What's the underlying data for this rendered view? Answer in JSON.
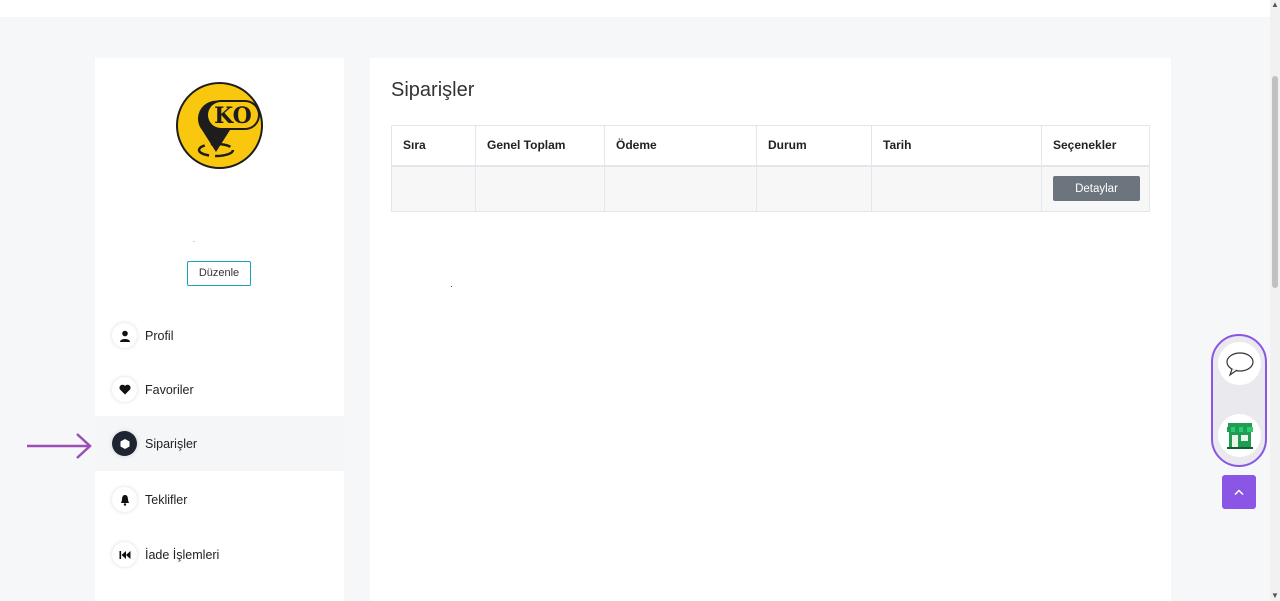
{
  "sidebar": {
    "edit_button": "Düzenle",
    "items": [
      {
        "label": "Profil",
        "icon": "user-icon"
      },
      {
        "label": "Favoriler",
        "icon": "heart-icon"
      },
      {
        "label": "Siparişler",
        "icon": "hexagon-icon",
        "active": true
      },
      {
        "label": "Teklifler",
        "icon": "bell-icon"
      },
      {
        "label": "İade İşlemleri",
        "icon": "rewind-icon"
      }
    ]
  },
  "logo": {
    "text": "KO"
  },
  "main": {
    "title": "Siparişler",
    "table": {
      "headers": [
        "Sıra",
        "Genel Toplam",
        "Ödeme",
        "Durum",
        "Tarih",
        "Seçenekler"
      ],
      "rows": [
        {
          "detail_button": "Detaylar"
        }
      ]
    }
  },
  "colors": {
    "accent": "#8b55e6",
    "logo_yellow": "#f9c80e",
    "edit_border": "#17a2b8",
    "detail_button_bg": "#6c757d"
  }
}
